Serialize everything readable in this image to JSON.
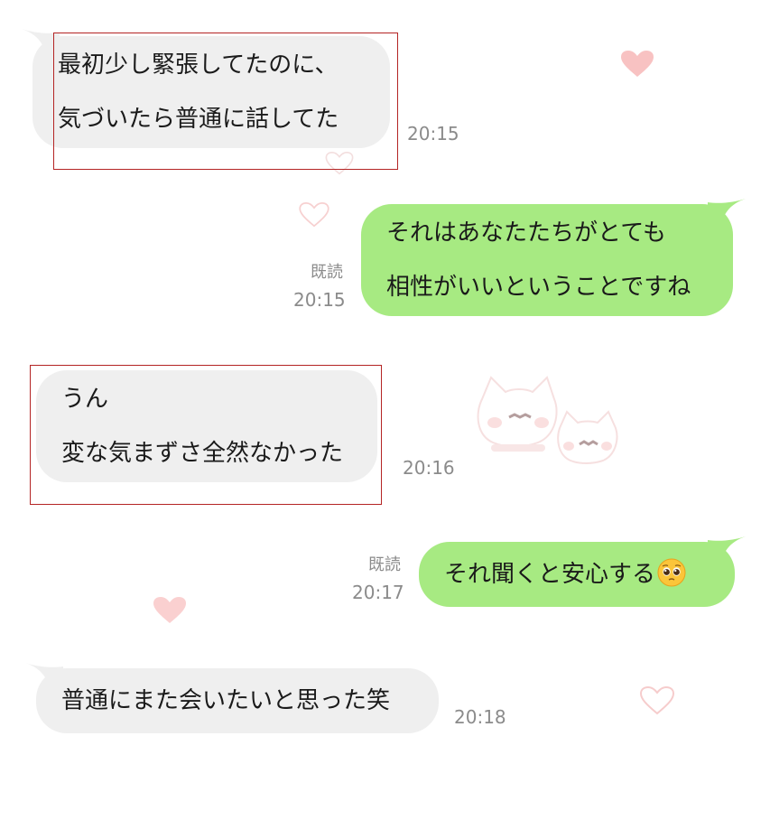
{
  "messages": [
    {
      "id": "m1",
      "lines": [
        "最初少し緊張してたのに、",
        "気づいたら普通に話してた"
      ],
      "time": "20:15"
    },
    {
      "id": "m2",
      "lines": [
        "それはあなたたちがとても",
        "相性がいいということですね"
      ],
      "read": "既読",
      "time": "20:15"
    },
    {
      "id": "m3",
      "lines": [
        "うん",
        "変な気まずさ全然なかった"
      ],
      "time": "20:16"
    },
    {
      "id": "m4",
      "text": "それ聞くと安心する",
      "emoji": "pleading-face-icon",
      "read": "既読",
      "time": "20:17"
    },
    {
      "id": "m5",
      "text": "普通にまた会いたいと思った笑",
      "time": "20:18"
    }
  ],
  "colors": {
    "received_bubble": "#efefef",
    "sent_bubble": "#a7ea82",
    "timestamp": "#8b8b8b",
    "highlight_box": "#b42424",
    "heart_pink": "#f7b8b8"
  }
}
